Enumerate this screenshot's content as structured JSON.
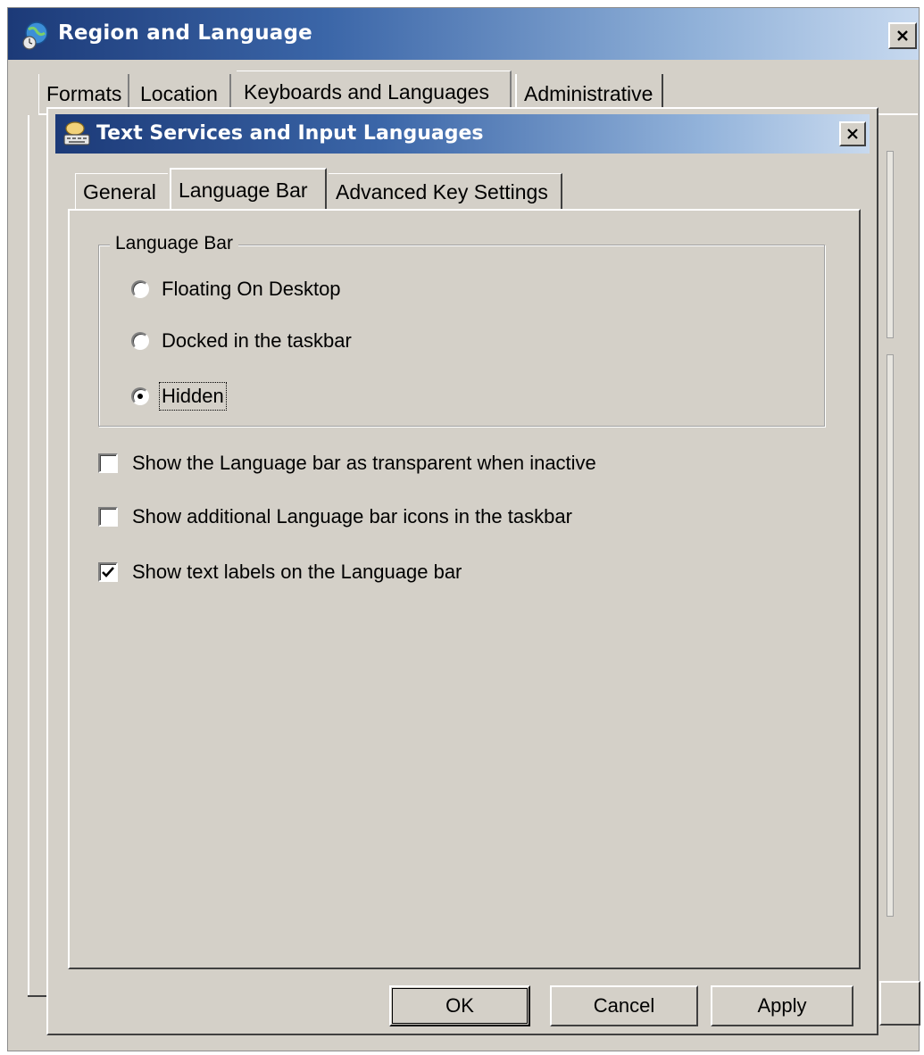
{
  "outer_window": {
    "title": "Region and Language",
    "tabs": [
      {
        "label": "Formats"
      },
      {
        "label": "Location"
      },
      {
        "label": "Keyboards and Languages"
      },
      {
        "label": "Administrative"
      }
    ],
    "selected_tab": "Keyboards and Languages"
  },
  "dialog": {
    "title": "Text Services and Input Languages",
    "tabs": [
      {
        "label": "General"
      },
      {
        "label": "Language Bar"
      },
      {
        "label": "Advanced Key Settings"
      }
    ],
    "selected_tab": "Language Bar",
    "language_bar_group": {
      "label": "Language Bar",
      "options": [
        {
          "label": "Floating On Desktop",
          "checked": false
        },
        {
          "label": "Docked in the taskbar",
          "checked": false
        },
        {
          "label": "Hidden",
          "checked": true
        }
      ]
    },
    "checkboxes": [
      {
        "label": "Show the Language bar as transparent when inactive",
        "checked": false
      },
      {
        "label": "Show additional Language bar icons in the taskbar",
        "checked": false
      },
      {
        "label": "Show text labels on the Language bar",
        "checked": true
      }
    ],
    "buttons": {
      "ok": "OK",
      "cancel": "Cancel",
      "apply": "Apply"
    }
  },
  "icons": {
    "outer_app": "region-globe-icon",
    "dialog_app": "keyboard-language-icon",
    "close": "close-icon",
    "check": "checkmark-icon"
  }
}
